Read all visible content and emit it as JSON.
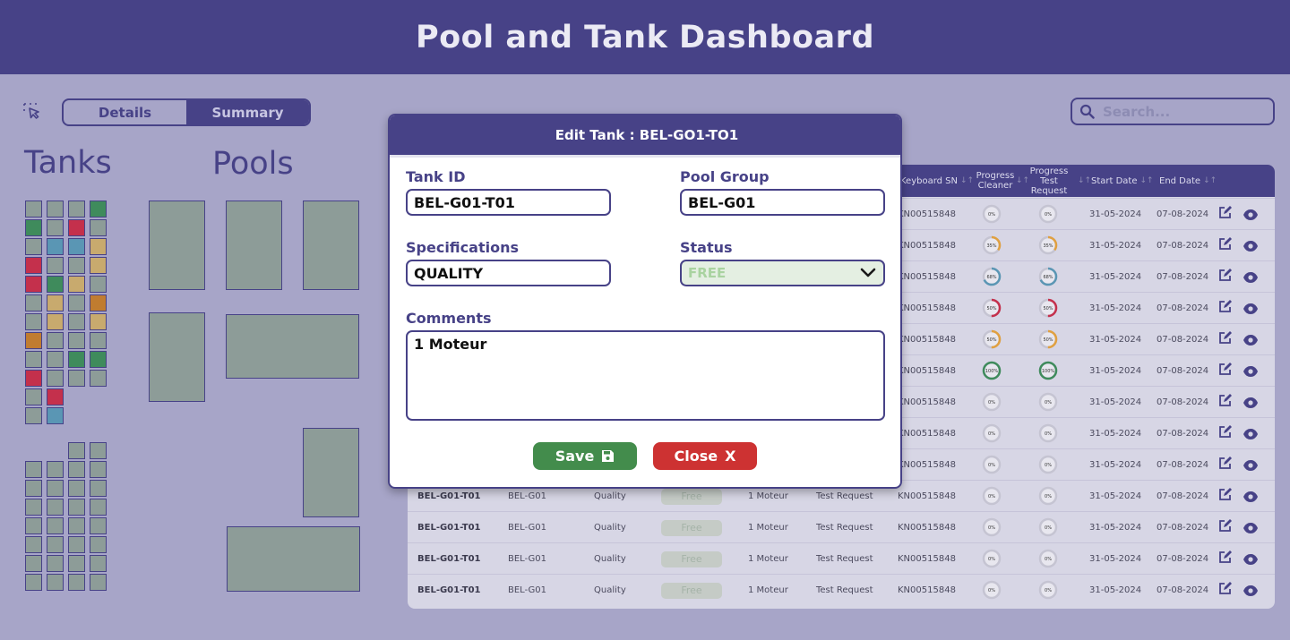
{
  "header": {
    "title": "Pool and Tank Dashboard"
  },
  "view_toggle": {
    "details_label": "Details",
    "summary_label": "Summary",
    "active": "Summary"
  },
  "sections": {
    "tanks_title": "Tanks",
    "pools_title": "Pools"
  },
  "search": {
    "placeholder": "Search..."
  },
  "colors": {
    "primary": "#474287",
    "background": "#a7a5c8",
    "tank_free": "#8d9c98",
    "tank_green": "#3f8b5c",
    "tank_red": "#c4304c",
    "tank_blue": "#5a96b4",
    "tank_tan": "#c8aa6e",
    "tank_orange": "#c07c30",
    "save_green": "#438c4c",
    "close_red": "#cd3232"
  },
  "tank_grid_top": [
    [
      "free",
      "free",
      "free",
      "green"
    ],
    [
      "green",
      "free",
      "red",
      "free"
    ],
    [
      "free",
      "blue",
      "blue",
      "tan"
    ],
    [
      "red",
      "free",
      "free",
      "tan"
    ],
    [
      "red",
      "green",
      "tan",
      "free"
    ],
    [
      "free",
      "tan",
      "free",
      "orange"
    ],
    [
      "free",
      "tan",
      "free",
      "tan"
    ],
    [
      "orange",
      "free",
      "free",
      "free"
    ],
    [
      "free",
      "free",
      "green",
      "green"
    ],
    [
      "red",
      "free",
      "free",
      "free"
    ],
    [
      "free",
      "red"
    ],
    [
      "free",
      "blue"
    ]
  ],
  "table": {
    "columns": [
      {
        "label": "Keyboard SN"
      },
      {
        "label": "Progress Cleaner"
      },
      {
        "label": "Progress Test Request"
      },
      {
        "label": "Start Date"
      },
      {
        "label": "End Date"
      }
    ],
    "rows": [
      {
        "tank_id": "",
        "pool_group": "",
        "spec": "",
        "status": "",
        "comments": "",
        "type": "",
        "keyboard_sn": "KN00515848",
        "cleaner": "0%",
        "cleaner_pct": 0,
        "test": "0%",
        "test_pct": 0,
        "start": "31-05-2024",
        "end": "07-08-2024"
      },
      {
        "tank_id": "",
        "pool_group": "",
        "spec": "",
        "status": "",
        "comments": "",
        "type": "",
        "keyboard_sn": "KN00515848",
        "cleaner": "35%",
        "cleaner_pct": 35,
        "test": "35%",
        "test_pct": 35,
        "start": "31-05-2024",
        "end": "07-08-2024"
      },
      {
        "tank_id": "",
        "pool_group": "",
        "spec": "",
        "status": "",
        "comments": "",
        "type": "",
        "keyboard_sn": "KN00515848",
        "cleaner": "68%",
        "cleaner_pct": 68,
        "test": "68%",
        "test_pct": 68,
        "start": "31-05-2024",
        "end": "07-08-2024"
      },
      {
        "tank_id": "",
        "pool_group": "",
        "spec": "",
        "status": "",
        "comments": "",
        "type": "",
        "keyboard_sn": "KN00515848",
        "cleaner": "50%",
        "cleaner_pct": 50,
        "test": "50%",
        "test_pct": 50,
        "start": "31-05-2024",
        "end": "07-08-2024"
      },
      {
        "tank_id": "",
        "pool_group": "",
        "spec": "",
        "status": "",
        "comments": "",
        "type": "",
        "keyboard_sn": "KN00515848",
        "cleaner": "50%",
        "cleaner_pct": 50,
        "test": "50%",
        "test_pct": 50,
        "start": "31-05-2024",
        "end": "07-08-2024"
      },
      {
        "tank_id": "",
        "pool_group": "",
        "spec": "",
        "status": "",
        "comments": "",
        "type": "",
        "keyboard_sn": "KN00515848",
        "cleaner": "100%",
        "cleaner_pct": 100,
        "test": "100%",
        "test_pct": 100,
        "start": "31-05-2024",
        "end": "07-08-2024"
      },
      {
        "tank_id": "",
        "pool_group": "",
        "spec": "",
        "status": "",
        "comments": "",
        "type": "",
        "keyboard_sn": "KN00515848",
        "cleaner": "0%",
        "cleaner_pct": 0,
        "test": "0%",
        "test_pct": 0,
        "start": "31-05-2024",
        "end": "07-08-2024"
      },
      {
        "tank_id": "",
        "pool_group": "",
        "spec": "",
        "status": "",
        "comments": "",
        "type": "",
        "keyboard_sn": "KN00515848",
        "cleaner": "0%",
        "cleaner_pct": 0,
        "test": "0%",
        "test_pct": 0,
        "start": "31-05-2024",
        "end": "07-08-2024"
      },
      {
        "tank_id": "",
        "pool_group": "",
        "spec": "",
        "status": "",
        "comments": "",
        "type": "",
        "keyboard_sn": "KN00515848",
        "cleaner": "0%",
        "cleaner_pct": 0,
        "test": "0%",
        "test_pct": 0,
        "start": "31-05-2024",
        "end": "07-08-2024"
      },
      {
        "tank_id": "BEL-G01-T01",
        "pool_group": "BEL-G01",
        "spec": "Quality",
        "status": "Free",
        "comments": "1 Moteur",
        "type": "Test Request",
        "keyboard_sn": "KN00515848",
        "cleaner": "0%",
        "cleaner_pct": 0,
        "test": "0%",
        "test_pct": 0,
        "start": "31-05-2024",
        "end": "07-08-2024"
      },
      {
        "tank_id": "BEL-G01-T01",
        "pool_group": "BEL-G01",
        "spec": "Quality",
        "status": "Free",
        "comments": "1 Moteur",
        "type": "Test Request",
        "keyboard_sn": "KN00515848",
        "cleaner": "0%",
        "cleaner_pct": 0,
        "test": "0%",
        "test_pct": 0,
        "start": "31-05-2024",
        "end": "07-08-2024"
      },
      {
        "tank_id": "BEL-G01-T01",
        "pool_group": "BEL-G01",
        "spec": "Quality",
        "status": "Free",
        "comments": "1 Moteur",
        "type": "Test Request",
        "keyboard_sn": "KN00515848",
        "cleaner": "0%",
        "cleaner_pct": 0,
        "test": "0%",
        "test_pct": 0,
        "start": "31-05-2024",
        "end": "07-08-2024"
      },
      {
        "tank_id": "BEL-G01-T01",
        "pool_group": "BEL-G01",
        "spec": "Quality",
        "status": "Free",
        "comments": "1 Moteur",
        "type": "Test Request",
        "keyboard_sn": "KN00515848",
        "cleaner": "0%",
        "cleaner_pct": 0,
        "test": "0%",
        "test_pct": 0,
        "start": "31-05-2024",
        "end": "07-08-2024"
      }
    ]
  },
  "modal": {
    "title": "Edit Tank : BEL-GO1-TO1",
    "tank_id_label": "Tank ID",
    "tank_id_value": "BEL-G01-T01",
    "pool_group_label": "Pool Group",
    "pool_group_value": "BEL-G01",
    "specifications_label": "Specifications",
    "specifications_value": "QUALITY",
    "status_label": "Status",
    "status_value": "FREE",
    "comments_label": "Comments",
    "comments_value": "1 Moteur",
    "save_label": "Save",
    "close_label": "Close",
    "close_glyph": "X"
  }
}
